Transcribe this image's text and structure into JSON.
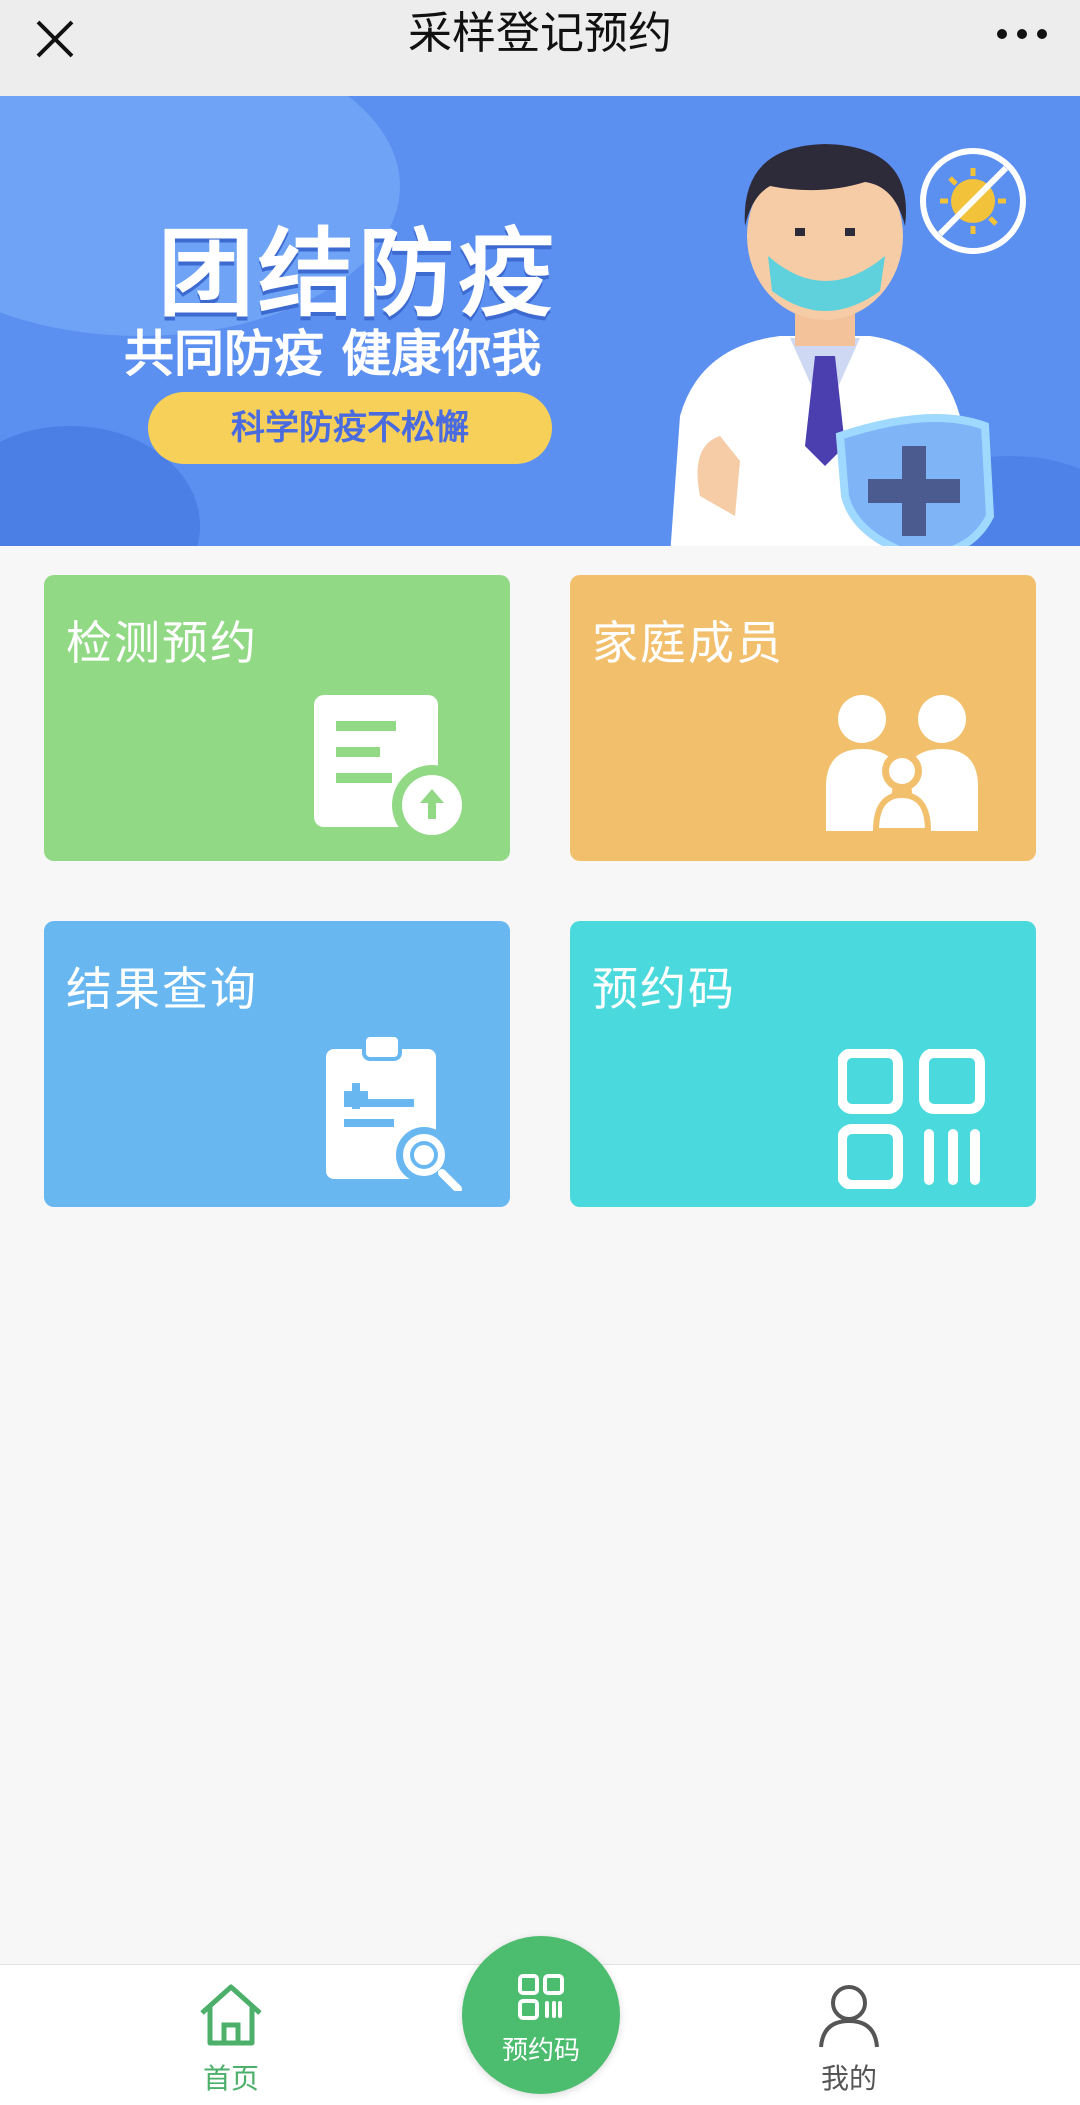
{
  "header": {
    "title": "采样登记预约",
    "close_icon": "close-icon",
    "more_icon": "more-horizontal-icon"
  },
  "banner": {
    "headline": "团结防疫",
    "subline": "共同防疫 健康你我",
    "pill": "科学防疫不松懈"
  },
  "grid": {
    "items": [
      {
        "label": "检测预约",
        "icon": "document-upload-icon",
        "color": "#92d985"
      },
      {
        "label": "家庭成员",
        "icon": "family-icon",
        "color": "#f2bf6d"
      },
      {
        "label": "结果查询",
        "icon": "clipboard-search-icon",
        "color": "#69b7f1"
      },
      {
        "label": "预约码",
        "icon": "qr-code-icon",
        "color": "#4ad9dc"
      }
    ]
  },
  "tabbar": {
    "home_label": "首页",
    "code_label": "预约码",
    "mine_label": "我的",
    "accent": "#4cbc6e"
  }
}
